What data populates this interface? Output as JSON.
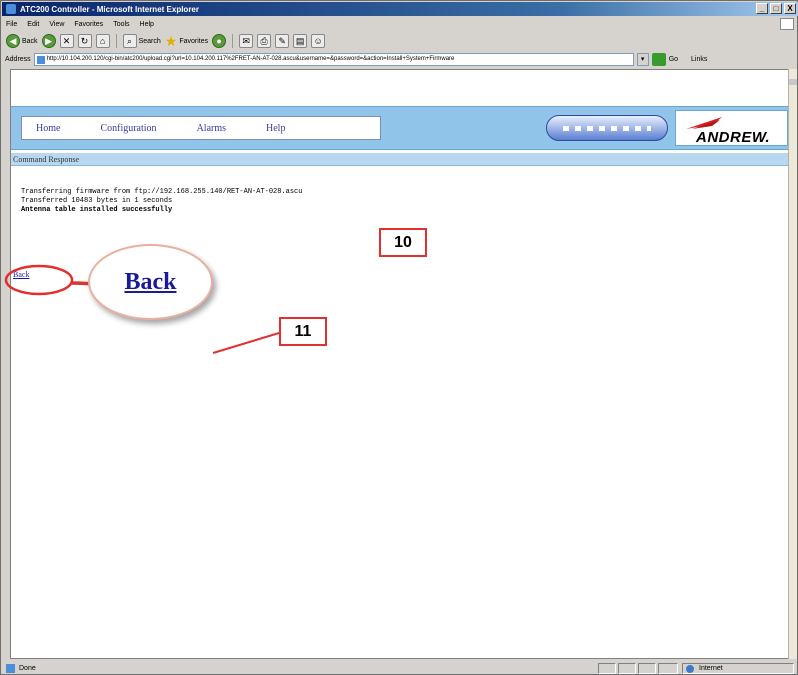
{
  "window": {
    "title": "ATC200 Controller - Microsoft Internet Explorer",
    "buttons": {
      "minimize": "_",
      "maximize": "□",
      "close": "X"
    }
  },
  "menu": {
    "items": [
      "File",
      "Edit",
      "View",
      "Favorites",
      "Tools",
      "Help"
    ]
  },
  "toolbar": {
    "back_label": "Back",
    "search_label": "Search",
    "favorites_label": "Favorites"
  },
  "address": {
    "label": "Address",
    "url": "http://10.104.200.120/cgi-bin/atc200/upload.cgi?url=10.104.200.117%2FRET-AN-AT-028.ascu&username=&password=&action=Install+System+Firmware",
    "go_label": "Go",
    "links_label": "Links"
  },
  "page": {
    "nav": [
      "Home",
      "Configuration",
      "Alarms",
      "Help"
    ],
    "brand": "ANDREW.",
    "section_title": "Command Response",
    "output_lines": [
      "Transferring firmware from ftp://192.168.255.140/RET-AN-AT-028.ascu",
      "Transferred 10483 bytes in 1 seconds"
    ],
    "success_line": "Antenna table installed successfully",
    "back_link": "Back"
  },
  "annotations": {
    "step_10": "10",
    "step_11": "11",
    "zoom_label": "Back",
    "accent_color": "#e03030"
  },
  "status": {
    "text": "Done",
    "zone": "Internet"
  }
}
